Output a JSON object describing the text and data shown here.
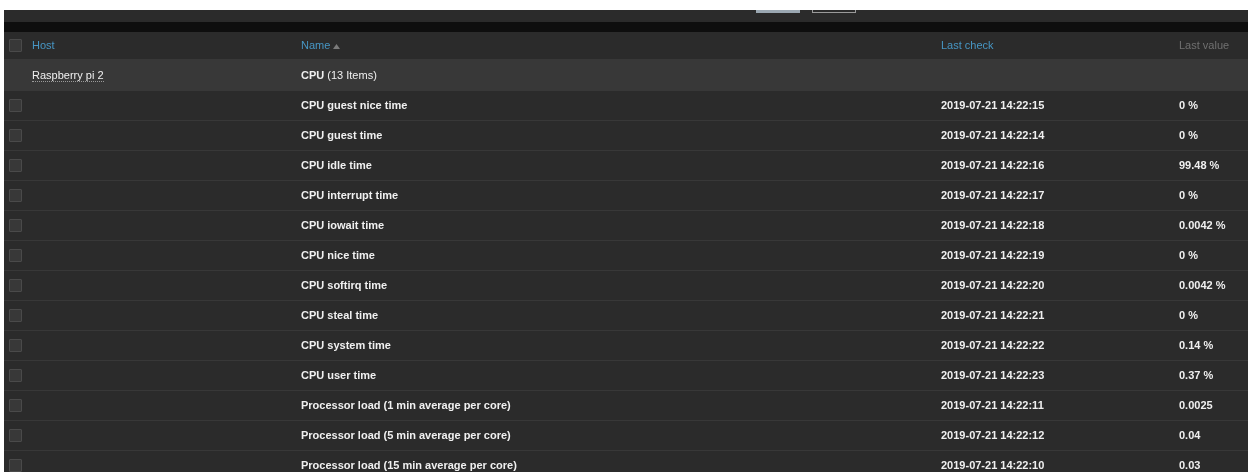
{
  "toolbar": {
    "buttons": [
      {
        "kind": "filled"
      },
      {
        "kind": "outline"
      }
    ]
  },
  "table": {
    "select_all": {
      "checked": false
    },
    "columns": [
      {
        "label": "Host",
        "sortable": true,
        "sorted": false
      },
      {
        "label": "Name",
        "sortable": true,
        "sorted": true
      },
      {
        "label": "Last check",
        "sortable": true,
        "sorted": false
      },
      {
        "label": "Last value",
        "sortable": false,
        "sorted": false
      }
    ],
    "group": {
      "host": "Raspberry pi 2",
      "name": "**CPU** (13 Items)"
    },
    "rows": [
      {
        "checked": false,
        "name": "CPU guest nice time",
        "last_check": "2019-07-21 14:22:15",
        "last_value": "0 %"
      },
      {
        "checked": false,
        "name": "CPU guest time",
        "last_check": "2019-07-21 14:22:14",
        "last_value": "0 %"
      },
      {
        "checked": false,
        "name": "CPU idle time",
        "last_check": "2019-07-21 14:22:16",
        "last_value": "99.48 %"
      },
      {
        "checked": false,
        "name": "CPU interrupt time",
        "last_check": "2019-07-21 14:22:17",
        "last_value": "0 %"
      },
      {
        "checked": false,
        "name": "CPU iowait time",
        "last_check": "2019-07-21 14:22:18",
        "last_value": "0.0042 %"
      },
      {
        "checked": false,
        "name": "CPU nice time",
        "last_check": "2019-07-21 14:22:19",
        "last_value": "0 %"
      },
      {
        "checked": false,
        "name": "CPU softirq time",
        "last_check": "2019-07-21 14:22:20",
        "last_value": "0.0042 %"
      },
      {
        "checked": false,
        "name": "CPU steal time",
        "last_check": "2019-07-21 14:22:21",
        "last_value": "0 %"
      },
      {
        "checked": false,
        "name": "CPU system time",
        "last_check": "2019-07-21 14:22:22",
        "last_value": "0.14 %"
      },
      {
        "checked": false,
        "name": "CPU user time",
        "last_check": "2019-07-21 14:22:23",
        "last_value": "0.37 %"
      },
      {
        "checked": false,
        "name": "Processor load (1 min average per core)",
        "last_check": "2019-07-21 14:22:11",
        "last_value": "0.0025"
      },
      {
        "checked": false,
        "name": "Processor load (5 min average per core)",
        "last_check": "2019-07-21 14:22:12",
        "last_value": "0.04"
      },
      {
        "checked": false,
        "name": "Processor load (15 min average per core)",
        "last_check": "2019-07-21 14:22:10",
        "last_value": "0.03"
      }
    ]
  }
}
